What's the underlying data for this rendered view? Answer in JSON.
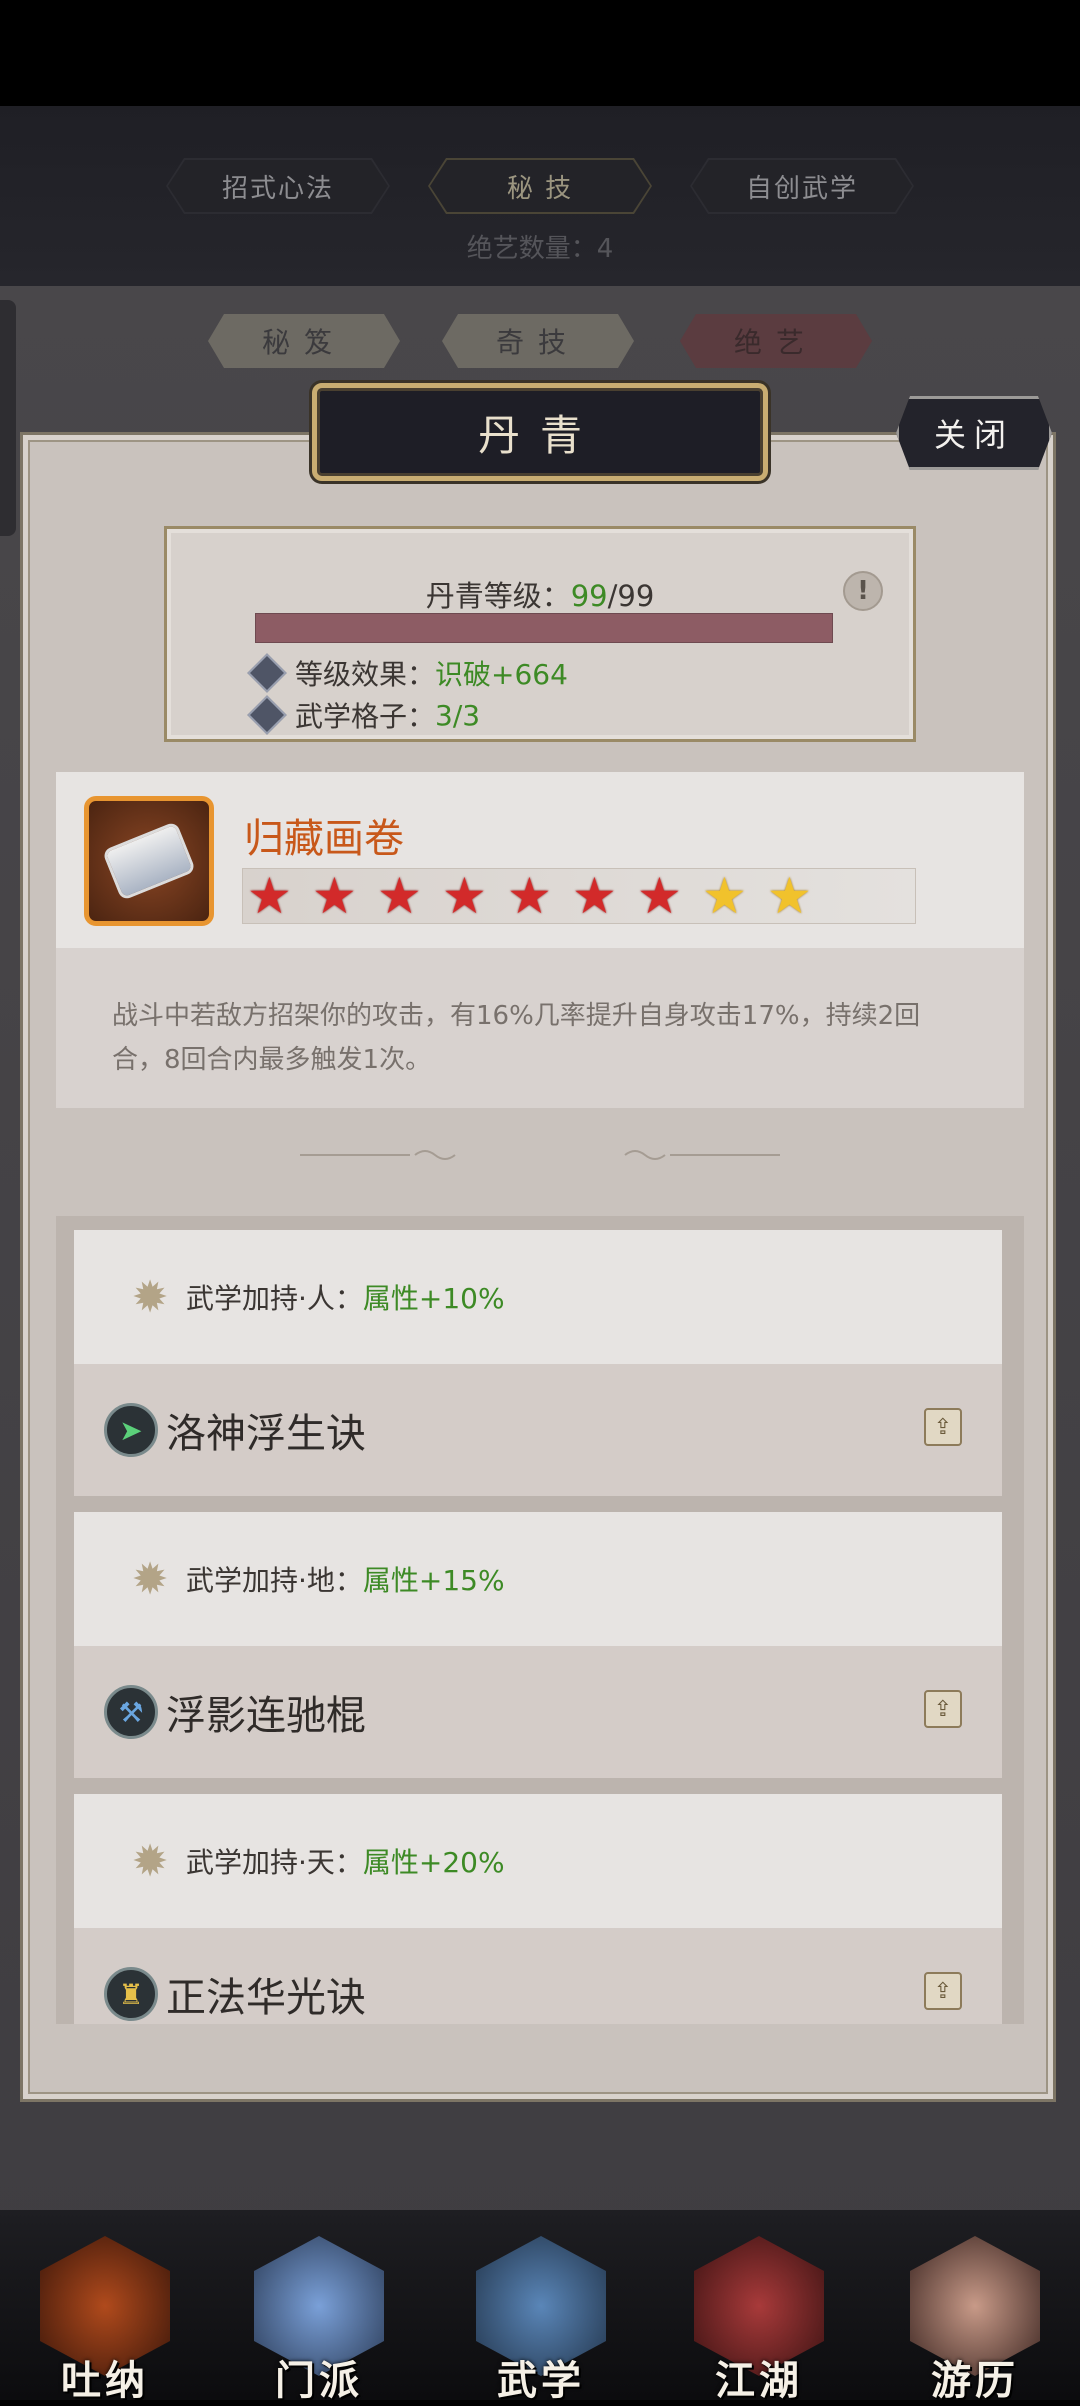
{
  "top_tabs": [
    {
      "label": "招式心法"
    },
    {
      "label": "秘 技"
    },
    {
      "label": "自创武学"
    }
  ],
  "count_label": "绝艺数量：4",
  "sub_tabs": [
    {
      "label": "秘笈"
    },
    {
      "label": "奇技"
    },
    {
      "label": "绝艺"
    }
  ],
  "panel": {
    "title": "丹青",
    "close_label": "关闭",
    "level": {
      "label": "丹青等级：",
      "current": "99",
      "max": "/99",
      "progress": 1.0,
      "info_icon": "!"
    },
    "stats": [
      {
        "label": "等级效果：",
        "value": "识破+664"
      },
      {
        "label": "武学格子：",
        "value": "3/3"
      }
    ]
  },
  "skill": {
    "name": "归藏画卷",
    "icon": "scroll-icon",
    "stars_red": 7,
    "stars_gold": 2,
    "description": "战斗中若敌方招架你的攻击，有16%几率提升自身攻击17%，持续2回合，8回合内最多触发1次。"
  },
  "bonuses": [
    {
      "label": "武学加持·人：",
      "value": "属性+10%",
      "move": "洛神浮生诀",
      "move_icon": "boot-icon"
    },
    {
      "label": "武学加持·地：",
      "value": "属性+15%",
      "move": "浮影连驰棍",
      "move_icon": "staff-icon"
    },
    {
      "label": "武学加持·天：",
      "value": "属性+20%",
      "move": "正法华光诀",
      "move_icon": "bell-icon"
    }
  ],
  "bottom_nav": [
    {
      "label": "吐纳",
      "color": "#8a2e12"
    },
    {
      "label": "门派",
      "color": "#4a6a9a"
    },
    {
      "label": "武学",
      "color": "#3b5f8c"
    },
    {
      "label": "江湖",
      "color": "#7a2222"
    },
    {
      "label": "游历",
      "color": "#8a5a4a"
    }
  ],
  "colors": {
    "accent_green": "#3d8a25",
    "skill_name_orange": "#c8581a",
    "title_gold": "#c9ad72"
  }
}
